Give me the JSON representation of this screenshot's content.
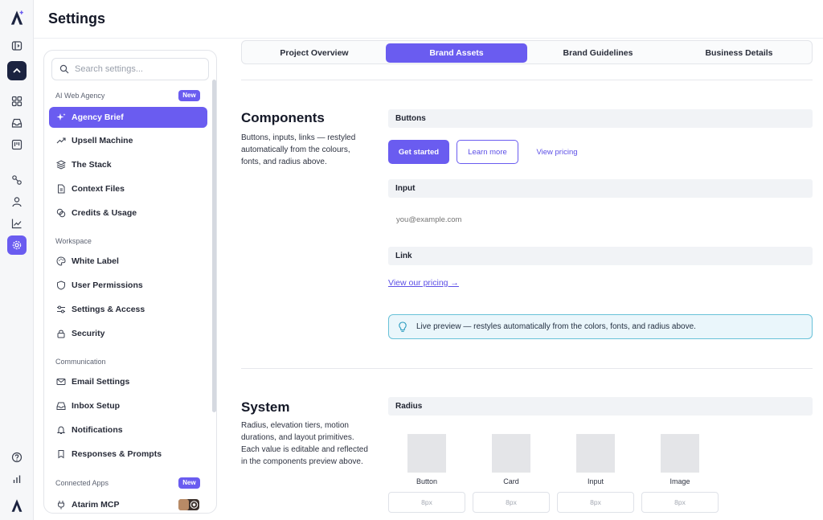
{
  "page": {
    "title": "Settings"
  },
  "colors": {
    "accent": "#6a5cf0",
    "rail_dark": "#1b2340",
    "preview_border": "#68c1d8",
    "preview_bg": "#eaf6fb"
  },
  "rail": {
    "icons": [
      "logo-icon",
      "sidebar-toggle-icon",
      "chevron-up-icon",
      "grid-icon",
      "inbox-icon",
      "kanban-icon",
      "nodes-icon",
      "user-icon",
      "chart-icon",
      "gear-icon",
      "help-icon",
      "bar-chart-icon",
      "brand-logo-icon"
    ]
  },
  "sidebar": {
    "search_placeholder": "Search settings...",
    "groups": [
      {
        "label": "AI Web Agency",
        "badge": "New",
        "items": [
          "Agency Brief",
          "Upsell Machine",
          "The Stack",
          "Context Files",
          "Credits & Usage"
        ]
      },
      {
        "label": "Workspace",
        "items": [
          "White Label",
          "User Permissions",
          "Settings & Access",
          "Security"
        ]
      },
      {
        "label": "Communication",
        "items": [
          "Email Settings",
          "Inbox Setup",
          "Notifications",
          "Responses & Prompts"
        ]
      },
      {
        "label": "Connected Apps",
        "badge": "New",
        "items": [
          "Atarim MCP"
        ]
      }
    ],
    "active_item": "Agency Brief"
  },
  "tabs": [
    {
      "label": "Project Overview",
      "active": false
    },
    {
      "label": "Brand Assets",
      "active": true
    },
    {
      "label": "Brand Guidelines",
      "active": false
    },
    {
      "label": "Business Details",
      "active": false
    }
  ],
  "components": {
    "title": "Components",
    "description": "Buttons, inputs, links — restyled automatically from the colours, fonts, and radius above.",
    "buttons_label": "Buttons",
    "primary_button": "Get started",
    "outline_button": "Learn more",
    "link_button": "View pricing",
    "input_label": "Input",
    "input_placeholder": "you@example.com",
    "link_label": "Link",
    "link_text": "View our pricing →",
    "preview_text": "Live preview — restyles automatically from the colors, fonts, and radius above."
  },
  "system": {
    "title": "System",
    "description": "Radius, elevation tiers, motion durations, and layout primitives. Each value is editable and reflected in the components preview above.",
    "radius_label": "Radius",
    "radius_items": [
      {
        "name": "Button",
        "value": "8px"
      },
      {
        "name": "Card",
        "value": "8px"
      },
      {
        "name": "Input",
        "value": "8px"
      },
      {
        "name": "Image",
        "value": "8px"
      }
    ]
  }
}
